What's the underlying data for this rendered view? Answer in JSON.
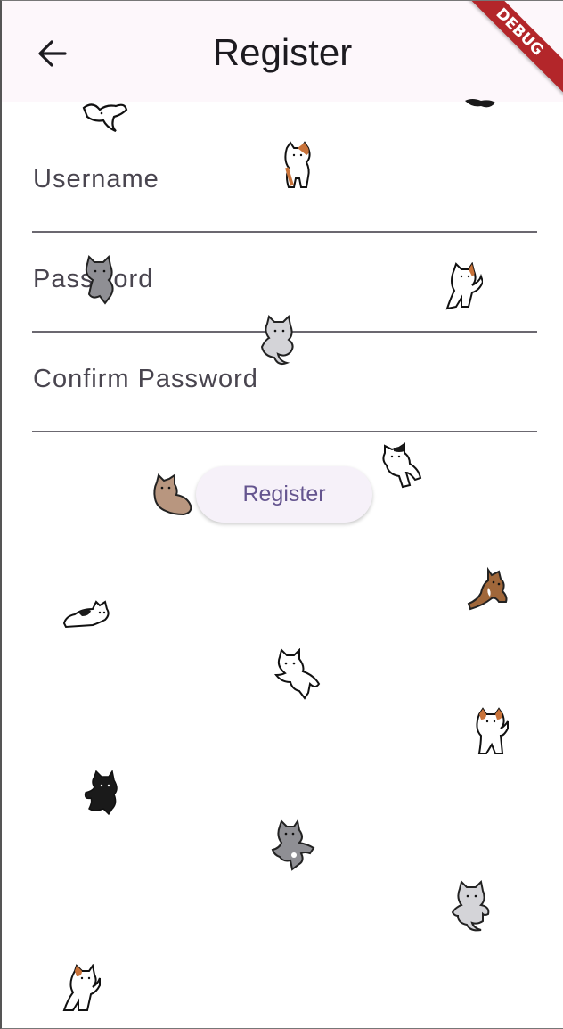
{
  "app_bar": {
    "title": "Register",
    "back_icon": "arrow-left-icon"
  },
  "debug_banner": "DEBUG",
  "form": {
    "fields": [
      {
        "label": "Username",
        "value": ""
      },
      {
        "label": "Password",
        "value": ""
      },
      {
        "label": "Confirm Password",
        "value": ""
      }
    ],
    "submit_label": "Register"
  },
  "decorations": {
    "icon": "cat-sticker-icon",
    "colors": {
      "white": "#ffffff",
      "black": "#1a1a1a",
      "gray": "#8f8f94",
      "light_gray": "#d4d4d8",
      "brown": "#a0673a",
      "tan": "#b8967f",
      "orange_patch": "#c9733a"
    }
  },
  "colors": {
    "app_bar_bg": "#fdf7fb",
    "button_text": "#65558f",
    "button_bg": "#f6f1f9",
    "debug_banner": "#b3262a",
    "underline": "#6b6870",
    "label": "#49454f"
  }
}
